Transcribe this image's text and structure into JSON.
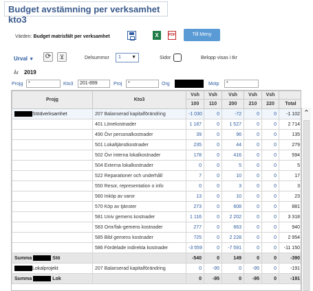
{
  "title": "Budget avstämning per verksamhet kto3",
  "toolbar": {
    "varden_label": "Värden:",
    "varden_value": "Budget matrisfält per verksamhet",
    "excel_glyph": "X",
    "pdf_glyph": "PDF",
    "menu_label": "Till Meny"
  },
  "controls": {
    "urval_label": "Urval",
    "delsummor_label": "Delsummor",
    "delsummor_value": "1",
    "sidor_label": "Sidor",
    "belopp_label": "Belopp visas i tkr"
  },
  "year": {
    "label": "År",
    "value": "2019"
  },
  "filters": {
    "projg_label": "Projg",
    "projg_value": "*",
    "kto3_label": "Kto3",
    "kto3_value": "201-899",
    "proj_label": "Proj",
    "proj_value": "*",
    "org_label": "Org",
    "motp_label": "Motp",
    "motp_value": "*"
  },
  "table": {
    "headers": {
      "projg": "Projg",
      "kto3": "Kto3",
      "vsh_top": "Vsh",
      "c100": "100",
      "c110": "110",
      "c200": "200",
      "c210": "210",
      "c220": "220",
      "total": "Total"
    },
    "rows": [
      {
        "projg": "Stödverksamhet",
        "kto3": "207 Balanserad kapitalförändring",
        "v100": "-1 030",
        "v110": "0",
        "v200": "-72",
        "v210": "0",
        "v220": "0",
        "total": "-1 102"
      },
      {
        "projg": "",
        "kto3": "401 Lönekostnader",
        "v100": "1 187",
        "v110": "0",
        "v200": "1 527",
        "v210": "0",
        "v220": "0",
        "total": "2 714"
      },
      {
        "projg": "",
        "kto3": "490 Övr personalkostnader",
        "v100": "39",
        "v110": "0",
        "v200": "96",
        "v210": "0",
        "v220": "0",
        "total": "135"
      },
      {
        "projg": "",
        "kto3": "501 Lokaltjänstkostnader",
        "v100": "235",
        "v110": "0",
        "v200": "44",
        "v210": "0",
        "v220": "0",
        "total": "279"
      },
      {
        "projg": "",
        "kto3": "502 Övr interna lokalkostnader",
        "v100": "178",
        "v110": "0",
        "v200": "416",
        "v210": "0",
        "v220": "0",
        "total": "594"
      },
      {
        "projg": "",
        "kto3": "504 Externa lokalkostnader",
        "v100": "0",
        "v110": "0",
        "v200": "5",
        "v210": "0",
        "v220": "0",
        "total": "5"
      },
      {
        "projg": "",
        "kto3": "522 Reparationer och underhåll",
        "v100": "7",
        "v110": "0",
        "v200": "10",
        "v210": "0",
        "v220": "0",
        "total": "17"
      },
      {
        "projg": "",
        "kto3": "550 Resor, representation o info",
        "v100": "0",
        "v110": "0",
        "v200": "3",
        "v210": "0",
        "v220": "0",
        "total": "3"
      },
      {
        "projg": "",
        "kto3": "560 Inköp av varor",
        "v100": "13",
        "v110": "0",
        "v200": "10",
        "v210": "0",
        "v220": "0",
        "total": "23"
      },
      {
        "projg": "",
        "kto3": "570 Köp av tjänster",
        "v100": "273",
        "v110": "0",
        "v200": "608",
        "v210": "0",
        "v220": "0",
        "total": "881"
      },
      {
        "projg": "",
        "kto3": "581 Univ gemens kostnader",
        "v100": "1 116",
        "v110": "0",
        "v200": "2 202",
        "v210": "0",
        "v220": "0",
        "total": "3 318"
      },
      {
        "projg": "",
        "kto3": "583 Omr/fak-gemens kostnader",
        "v100": "277",
        "v110": "0",
        "v200": "663",
        "v210": "0",
        "v220": "0",
        "total": "940"
      },
      {
        "projg": "",
        "kto3": "585 Bibl gemens kostnader",
        "v100": "725",
        "v110": "0",
        "v200": "2 228",
        "v210": "0",
        "v220": "0",
        "total": "2 954"
      },
      {
        "projg": "",
        "kto3": "586 Fördelade indirekta kostnader",
        "v100": "-3 559",
        "v110": "0",
        "v200": "-7 591",
        "v210": "0",
        "v220": "0",
        "total": "-11 150"
      }
    ],
    "sum1": {
      "label_a": "Summa",
      "label_b": "Stö",
      "v100": "-540",
      "v110": "0",
      "v200": "149",
      "v210": "0",
      "v220": "0",
      "total": "-390"
    },
    "row2": {
      "projg": "Lokalprojekt",
      "kto3": "207 Balanserad kapitalförändring",
      "v100": "0",
      "v110": "-95",
      "v200": "0",
      "v210": "-95",
      "v220": "0",
      "total": "-191"
    },
    "sum2": {
      "label_a": "Summa",
      "label_b": "Lok",
      "v100": "0",
      "v110": "-95",
      "v200": "0",
      "v210": "-95",
      "v220": "0",
      "total": "-191"
    }
  }
}
